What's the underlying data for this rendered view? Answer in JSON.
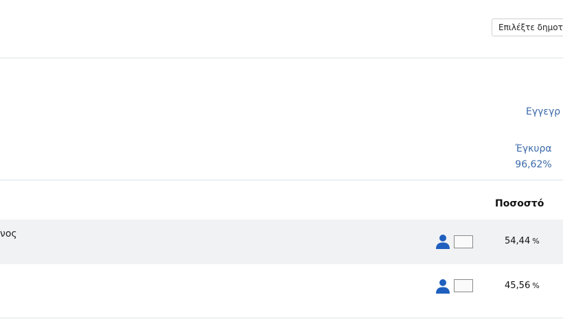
{
  "header": {
    "municipality_select": {
      "value": "Επιλέξτε δημοτ"
    }
  },
  "summary": {
    "registered_label": "Εγγεγρ",
    "valid_label": "Έγκυρα",
    "valid_percent": "96,62%"
  },
  "results": {
    "column_header": "Ποσοστό",
    "rows": [
      {
        "name": "νος",
        "percent": "54,44",
        "percent_sign": "%"
      },
      {
        "name": "",
        "percent": "45,56",
        "percent_sign": "%"
      }
    ]
  },
  "colors": {
    "link_blue": "#3b6aa8",
    "icon_blue": "#1f5fbf",
    "divider": "#d9e4e7",
    "row_alt_bg": "#f1f2f4"
  },
  "icons": [
    "person-icon",
    "candidate-photo-placeholder"
  ]
}
